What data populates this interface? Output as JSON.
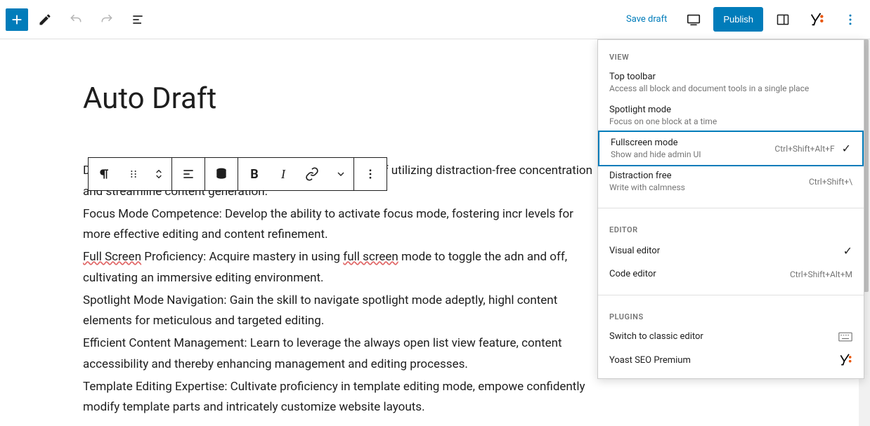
{
  "topbar": {
    "save_draft": "Save draft",
    "publish": "Publish"
  },
  "post": {
    "title": "Auto Draft",
    "p1a": "Distraction-Free Mastery: Attain a deep comprehension of utilizing distraction-free concentration and streamline content generation.",
    "p2": "Focus Mode Competence: Develop the ability to activate focus mode, fostering incr levels for more effective editing and content refinement.",
    "p3a": "Full Screen",
    "p3b": " Proficiency: Acquire mastery in using ",
    "p3c": "full screen",
    "p3d": " mode to toggle the adn and off, cultivating an immersive editing environment.",
    "p4": "Spotlight Mode Navigation: Gain the skill to navigate spotlight mode adeptly, highl content elements for meticulous and targeted editing.",
    "p5": "Efficient Content Management: Learn to leverage the always open list view feature, content accessibility and thereby enhancing management and editing processes.",
    "p6": "Template Editing Expertise: Cultivate proficiency in template editing mode, empowe confidently modify template parts and intricately customize website layouts."
  },
  "menu": {
    "view_heading": "View",
    "top_toolbar": {
      "title": "Top toolbar",
      "desc": "Access all block and document tools in a single place"
    },
    "spotlight": {
      "title": "Spotlight mode",
      "desc": "Focus on one block at a time"
    },
    "fullscreen": {
      "title": "Fullscreen mode",
      "desc": "Show and hide admin UI",
      "shortcut": "Ctrl+Shift+Alt+F"
    },
    "distraction": {
      "title": "Distraction free",
      "desc": "Write with calmness",
      "shortcut": "Ctrl+Shift+\\"
    },
    "editor_heading": "Editor",
    "visual": {
      "title": "Visual editor"
    },
    "code": {
      "title": "Code editor",
      "shortcut": "Ctrl+Shift+Alt+M"
    },
    "plugins_heading": "Plugins",
    "classic": {
      "title": "Switch to classic editor"
    },
    "yoast": {
      "title": "Yoast SEO Premium"
    }
  }
}
